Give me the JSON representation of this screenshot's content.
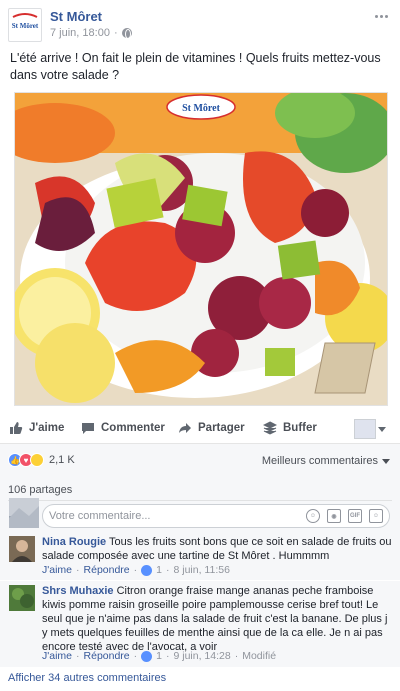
{
  "post": {
    "page_name": "St Môret",
    "logo_text": "St Môret",
    "timestamp": "7 juin, 18:00",
    "separator": "·",
    "text": "L'été arrive ! On fait le plein de vitamines ! Quels fruits mettez-vous dans votre salade ?",
    "image_logo_text": "St Môret",
    "icons": {
      "audience": "globe-icon",
      "options": "more-dots-icon"
    }
  },
  "actions": {
    "like": "J'aime",
    "comment": "Commenter",
    "share": "Partager",
    "buffer": "Buffer",
    "icons": {
      "like": "thumbs-up-icon",
      "comment": "speech-bubble-icon",
      "share": "share-arrow-icon",
      "buffer": "buffer-stack-icon"
    }
  },
  "social": {
    "reaction_count": "2,1 K",
    "reactions": [
      "like",
      "love",
      "wow"
    ],
    "best_comments": "Meilleurs commentaires",
    "shares": "106 partages"
  },
  "composer": {
    "placeholder": "Votre commentaire...",
    "icons": [
      "emoji-icon",
      "camera-icon",
      "gif-icon",
      "sticker-icon"
    ],
    "gif_label": "GIF"
  },
  "comments": [
    {
      "author": "Nina Rougie",
      "text": "Tous les fruits sont bons que ce soit en salade de fruits ou salade composée avec une tartine de St Môret . Hummmm",
      "like": "J'aime",
      "reply": "Répondre",
      "likes": "1",
      "time": "8 juin, 11:56"
    },
    {
      "author": "Shrs Muhaxie",
      "text": "Citron orange fraise mange ananas peche framboise kiwis pomme raisin groseille poire pamplemousse cerise bref tout! Le seul que je n'aime pas dans la salade de fruit c'est la banane. De plus j y mets quelques feuilles de menthe ainsi que de la ca elle. Je n ai pas encore testé avec de l'avocat, a voir",
      "like": "J'aime",
      "reply": "Répondre",
      "likes": "1",
      "time": "9 juin, 14:28",
      "edited": "Modifié"
    }
  ],
  "more_comments": "Afficher 34 autres commentaires",
  "colors": {
    "link": "#365899",
    "meta": "#90949c",
    "brand_blue": "#1f4fa0",
    "brand_red": "#d62e2e"
  }
}
